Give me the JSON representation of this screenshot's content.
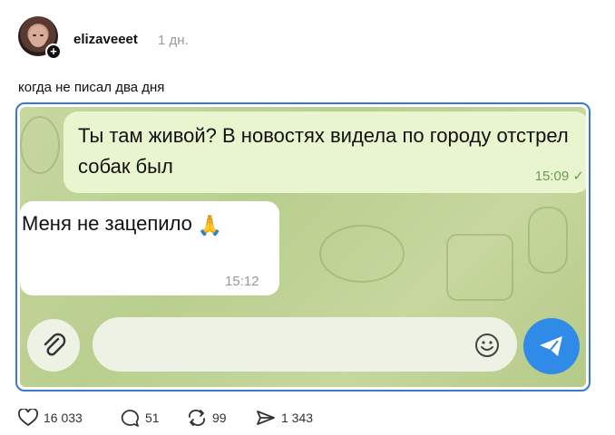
{
  "post": {
    "username": "elizaveeet",
    "time": "1 дн.",
    "caption": "когда не писал два дня"
  },
  "chat": {
    "outgoing": {
      "text": "Ты там живой? В новостях видела по городу отстрел собак был",
      "time": "15:09"
    },
    "incoming": {
      "text": "Меня не зацепило",
      "emoji": "🙏",
      "time": "15:12"
    },
    "icons": {
      "attach": "paperclip-icon",
      "emoji": "smiley-icon",
      "send": "send-icon"
    },
    "colors": {
      "send_button": "#2f8ae8",
      "outgoing_bubble": "#e8f5cf",
      "chat_background": "#c6d7a0"
    }
  },
  "actions": {
    "likes": "16 033",
    "comments": "51",
    "reposts": "99",
    "shares": "1 343"
  },
  "colors": {
    "media_border": "#3a78d8",
    "muted_text": "#9a9a9a"
  }
}
